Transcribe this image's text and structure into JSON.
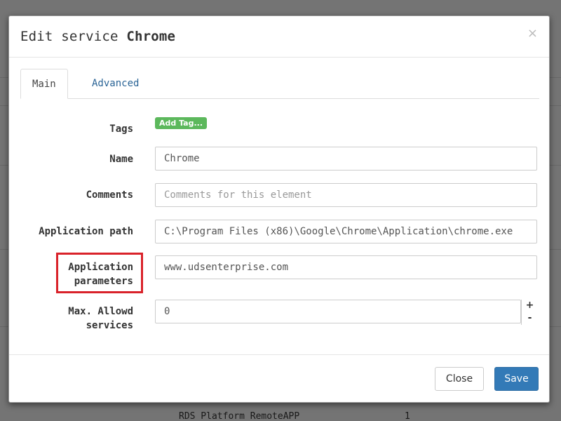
{
  "background": {
    "fragments": [
      "RDS Platform RemoteAPP",
      "1"
    ]
  },
  "dialog": {
    "title_prefix": "Edit service",
    "title_name": "Chrome",
    "close_glyph": "×"
  },
  "tabs": [
    {
      "label": "Main",
      "active": true
    },
    {
      "label": "Advanced",
      "active": false
    }
  ],
  "form": {
    "tags": {
      "label": "Tags",
      "add_tag_label": "Add Tag..."
    },
    "name": {
      "label": "Name",
      "value": "Chrome"
    },
    "comments": {
      "label": "Comments",
      "value": "",
      "placeholder": "Comments for this element"
    },
    "app_path": {
      "label": "Application path",
      "value": "C:\\Program Files (x86)\\Google\\Chrome\\Application\\chrome.exe"
    },
    "app_params": {
      "label_line1": "Application",
      "label_line2": "parameters",
      "value": "www.udsenterprise.com"
    },
    "max_services": {
      "label_line1": "Max. Allowd",
      "label_line2": "services",
      "value": "0",
      "plus": "+",
      "minus": "-"
    }
  },
  "footer": {
    "close_label": "Close",
    "save_label": "Save"
  },
  "colors": {
    "highlight": "#d9222a",
    "primary": "#337ab7",
    "success": "#5cb85c"
  }
}
